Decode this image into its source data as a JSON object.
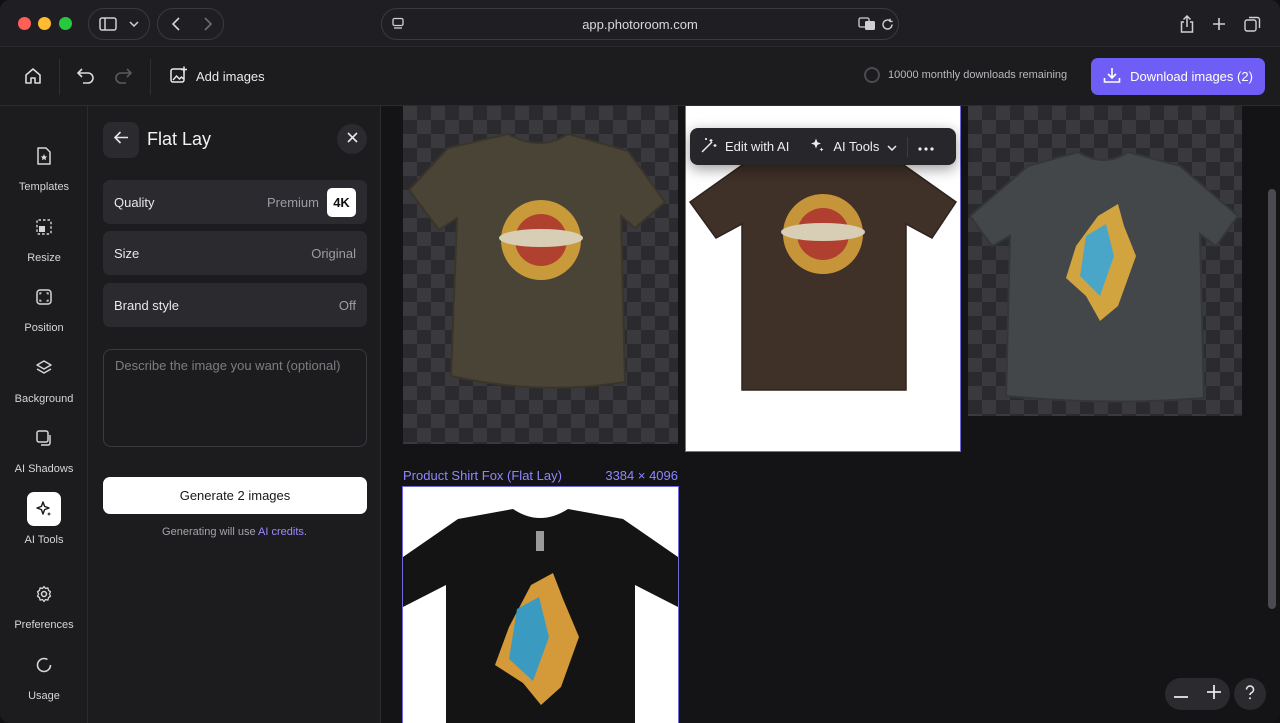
{
  "browser": {
    "url": "app.photoroom.com"
  },
  "toolbar": {
    "add_images_label": "Add images",
    "downloads_remaining": "10000 monthly downloads remaining",
    "download_label": "Download images (2)",
    "accent_color": "#6e5ef5"
  },
  "rail": {
    "items": [
      {
        "label": "Templates",
        "icon": "template-icon"
      },
      {
        "label": "Resize",
        "icon": "resize-icon"
      },
      {
        "label": "Position",
        "icon": "position-icon"
      },
      {
        "label": "Background",
        "icon": "layers-icon"
      },
      {
        "label": "AI Shadows",
        "icon": "shadow-icon"
      },
      {
        "label": "AI Tools",
        "icon": "sparkle-icon",
        "active": true
      },
      {
        "label": "Preferences",
        "icon": "gear-icon"
      },
      {
        "label": "Usage",
        "icon": "usage-ring-icon"
      }
    ]
  },
  "panel": {
    "title": "Flat Lay",
    "settings": [
      {
        "label": "Quality",
        "value": "Premium",
        "badge": "4K"
      },
      {
        "label": "Size",
        "value": "Original"
      },
      {
        "label": "Brand style",
        "value": "Off"
      }
    ],
    "prompt_placeholder": "Describe the image you want (optional)",
    "generate_label": "Generate 2 images",
    "credits_prefix": "Generating will use ",
    "credits_link": "AI credits",
    "credits_suffix": "."
  },
  "canvas": {
    "floating_bar": {
      "edit_label": "Edit with AI",
      "tools_label": "AI Tools"
    },
    "caption_name": "Product Shirt Fox (Flat Lay)",
    "caption_size": "3384 × 4096"
  }
}
